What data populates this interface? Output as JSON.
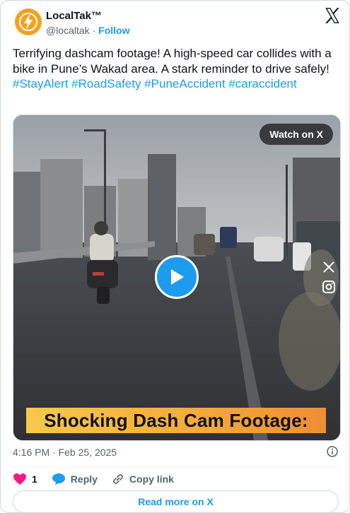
{
  "author": {
    "name": "LocalTak™",
    "handle": "@localtak",
    "separator": "·",
    "follow_label": "Follow"
  },
  "tweet": {
    "text": "Terrifying dashcam footage! A high-speed car collides with a bike in Pune’s Wakad area. A stark reminder to drive safely!",
    "hashtags": [
      "#StayAlert",
      "#RoadSafety",
      "#PuneAccident",
      "#caraccident"
    ]
  },
  "media": {
    "watch_label": "Watch on X",
    "caption": "Shocking Dash Cam Footage:"
  },
  "timestamp": "4:16 PM · Feb 25, 2025",
  "actions": {
    "like_count": "1",
    "reply_label": "Reply",
    "copy_label": "Copy link"
  },
  "read_more_label": "Read more on X",
  "colors": {
    "accent": "#1d9bf0",
    "like": "#f91880",
    "brand": "#f4a21c"
  },
  "icons": [
    "x-logo-icon",
    "play-icon",
    "close-icon",
    "instagram-icon",
    "info-icon",
    "heart-icon",
    "reply-icon",
    "link-icon"
  ]
}
